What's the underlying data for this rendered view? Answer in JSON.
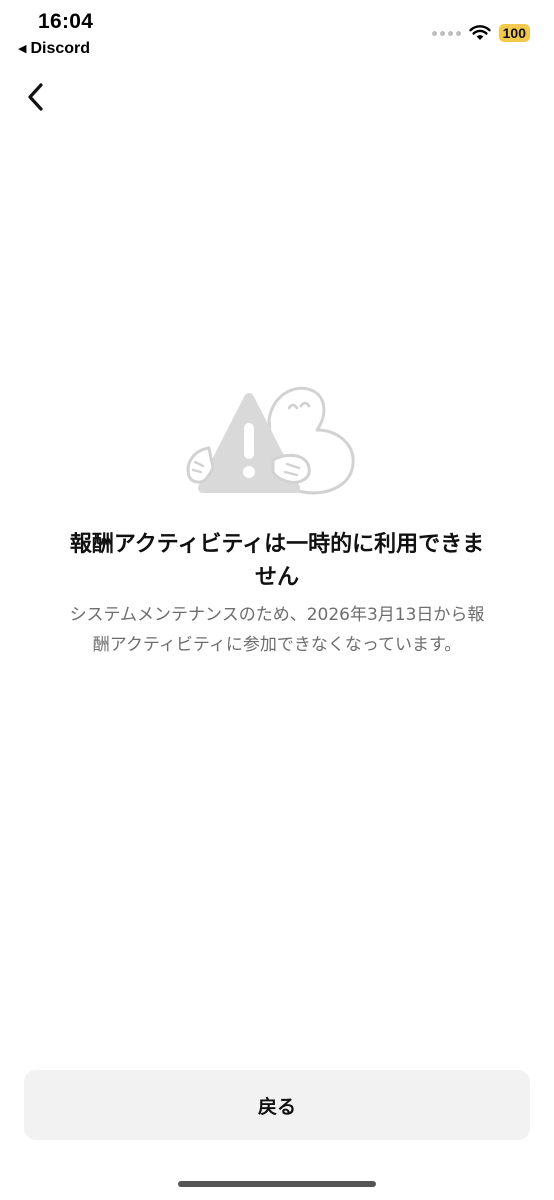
{
  "status_bar": {
    "time": "16:04",
    "back_app_label": "Discord",
    "battery_level": "100",
    "wifi_icon": "wifi-icon"
  },
  "nav": {
    "back_icon": "chevron-left-icon"
  },
  "illustration": {
    "icon": "warning-mascot-illustration"
  },
  "message": {
    "title": "報酬アクティビティは一時的に利用できません",
    "description": "システムメンテナンスのため、2026年3月13日から報酬アクティビティに参加できなくなっています。"
  },
  "actions": {
    "back_label": "戻る"
  },
  "colors": {
    "battery": "#f2c94c",
    "button_background": "#f2f2f2",
    "illustration_gray": "#d9d9d9",
    "description_text": "#6e6e6e"
  }
}
